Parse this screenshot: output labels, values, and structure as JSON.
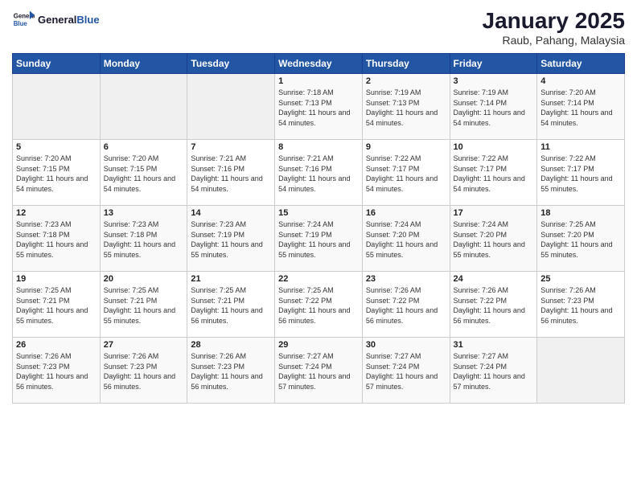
{
  "logo": {
    "text_general": "General",
    "text_blue": "Blue"
  },
  "title": "January 2025",
  "subtitle": "Raub, Pahang, Malaysia",
  "headers": [
    "Sunday",
    "Monday",
    "Tuesday",
    "Wednesday",
    "Thursday",
    "Friday",
    "Saturday"
  ],
  "weeks": [
    [
      {
        "day": "",
        "sunrise": "",
        "sunset": "",
        "daylight": ""
      },
      {
        "day": "",
        "sunrise": "",
        "sunset": "",
        "daylight": ""
      },
      {
        "day": "",
        "sunrise": "",
        "sunset": "",
        "daylight": ""
      },
      {
        "day": "1",
        "sunrise": "Sunrise: 7:18 AM",
        "sunset": "Sunset: 7:13 PM",
        "daylight": "Daylight: 11 hours and 54 minutes."
      },
      {
        "day": "2",
        "sunrise": "Sunrise: 7:19 AM",
        "sunset": "Sunset: 7:13 PM",
        "daylight": "Daylight: 11 hours and 54 minutes."
      },
      {
        "day": "3",
        "sunrise": "Sunrise: 7:19 AM",
        "sunset": "Sunset: 7:14 PM",
        "daylight": "Daylight: 11 hours and 54 minutes."
      },
      {
        "day": "4",
        "sunrise": "Sunrise: 7:20 AM",
        "sunset": "Sunset: 7:14 PM",
        "daylight": "Daylight: 11 hours and 54 minutes."
      }
    ],
    [
      {
        "day": "5",
        "sunrise": "Sunrise: 7:20 AM",
        "sunset": "Sunset: 7:15 PM",
        "daylight": "Daylight: 11 hours and 54 minutes."
      },
      {
        "day": "6",
        "sunrise": "Sunrise: 7:20 AM",
        "sunset": "Sunset: 7:15 PM",
        "daylight": "Daylight: 11 hours and 54 minutes."
      },
      {
        "day": "7",
        "sunrise": "Sunrise: 7:21 AM",
        "sunset": "Sunset: 7:16 PM",
        "daylight": "Daylight: 11 hours and 54 minutes."
      },
      {
        "day": "8",
        "sunrise": "Sunrise: 7:21 AM",
        "sunset": "Sunset: 7:16 PM",
        "daylight": "Daylight: 11 hours and 54 minutes."
      },
      {
        "day": "9",
        "sunrise": "Sunrise: 7:22 AM",
        "sunset": "Sunset: 7:17 PM",
        "daylight": "Daylight: 11 hours and 54 minutes."
      },
      {
        "day": "10",
        "sunrise": "Sunrise: 7:22 AM",
        "sunset": "Sunset: 7:17 PM",
        "daylight": "Daylight: 11 hours and 54 minutes."
      },
      {
        "day": "11",
        "sunrise": "Sunrise: 7:22 AM",
        "sunset": "Sunset: 7:17 PM",
        "daylight": "Daylight: 11 hours and 55 minutes."
      }
    ],
    [
      {
        "day": "12",
        "sunrise": "Sunrise: 7:23 AM",
        "sunset": "Sunset: 7:18 PM",
        "daylight": "Daylight: 11 hours and 55 minutes."
      },
      {
        "day": "13",
        "sunrise": "Sunrise: 7:23 AM",
        "sunset": "Sunset: 7:18 PM",
        "daylight": "Daylight: 11 hours and 55 minutes."
      },
      {
        "day": "14",
        "sunrise": "Sunrise: 7:23 AM",
        "sunset": "Sunset: 7:19 PM",
        "daylight": "Daylight: 11 hours and 55 minutes."
      },
      {
        "day": "15",
        "sunrise": "Sunrise: 7:24 AM",
        "sunset": "Sunset: 7:19 PM",
        "daylight": "Daylight: 11 hours and 55 minutes."
      },
      {
        "day": "16",
        "sunrise": "Sunrise: 7:24 AM",
        "sunset": "Sunset: 7:20 PM",
        "daylight": "Daylight: 11 hours and 55 minutes."
      },
      {
        "day": "17",
        "sunrise": "Sunrise: 7:24 AM",
        "sunset": "Sunset: 7:20 PM",
        "daylight": "Daylight: 11 hours and 55 minutes."
      },
      {
        "day": "18",
        "sunrise": "Sunrise: 7:25 AM",
        "sunset": "Sunset: 7:20 PM",
        "daylight": "Daylight: 11 hours and 55 minutes."
      }
    ],
    [
      {
        "day": "19",
        "sunrise": "Sunrise: 7:25 AM",
        "sunset": "Sunset: 7:21 PM",
        "daylight": "Daylight: 11 hours and 55 minutes."
      },
      {
        "day": "20",
        "sunrise": "Sunrise: 7:25 AM",
        "sunset": "Sunset: 7:21 PM",
        "daylight": "Daylight: 11 hours and 55 minutes."
      },
      {
        "day": "21",
        "sunrise": "Sunrise: 7:25 AM",
        "sunset": "Sunset: 7:21 PM",
        "daylight": "Daylight: 11 hours and 56 minutes."
      },
      {
        "day": "22",
        "sunrise": "Sunrise: 7:25 AM",
        "sunset": "Sunset: 7:22 PM",
        "daylight": "Daylight: 11 hours and 56 minutes."
      },
      {
        "day": "23",
        "sunrise": "Sunrise: 7:26 AM",
        "sunset": "Sunset: 7:22 PM",
        "daylight": "Daylight: 11 hours and 56 minutes."
      },
      {
        "day": "24",
        "sunrise": "Sunrise: 7:26 AM",
        "sunset": "Sunset: 7:22 PM",
        "daylight": "Daylight: 11 hours and 56 minutes."
      },
      {
        "day": "25",
        "sunrise": "Sunrise: 7:26 AM",
        "sunset": "Sunset: 7:23 PM",
        "daylight": "Daylight: 11 hours and 56 minutes."
      }
    ],
    [
      {
        "day": "26",
        "sunrise": "Sunrise: 7:26 AM",
        "sunset": "Sunset: 7:23 PM",
        "daylight": "Daylight: 11 hours and 56 minutes."
      },
      {
        "day": "27",
        "sunrise": "Sunrise: 7:26 AM",
        "sunset": "Sunset: 7:23 PM",
        "daylight": "Daylight: 11 hours and 56 minutes."
      },
      {
        "day": "28",
        "sunrise": "Sunrise: 7:26 AM",
        "sunset": "Sunset: 7:23 PM",
        "daylight": "Daylight: 11 hours and 56 minutes."
      },
      {
        "day": "29",
        "sunrise": "Sunrise: 7:27 AM",
        "sunset": "Sunset: 7:24 PM",
        "daylight": "Daylight: 11 hours and 57 minutes."
      },
      {
        "day": "30",
        "sunrise": "Sunrise: 7:27 AM",
        "sunset": "Sunset: 7:24 PM",
        "daylight": "Daylight: 11 hours and 57 minutes."
      },
      {
        "day": "31",
        "sunrise": "Sunrise: 7:27 AM",
        "sunset": "Sunset: 7:24 PM",
        "daylight": "Daylight: 11 hours and 57 minutes."
      },
      {
        "day": "",
        "sunrise": "",
        "sunset": "",
        "daylight": ""
      }
    ]
  ]
}
